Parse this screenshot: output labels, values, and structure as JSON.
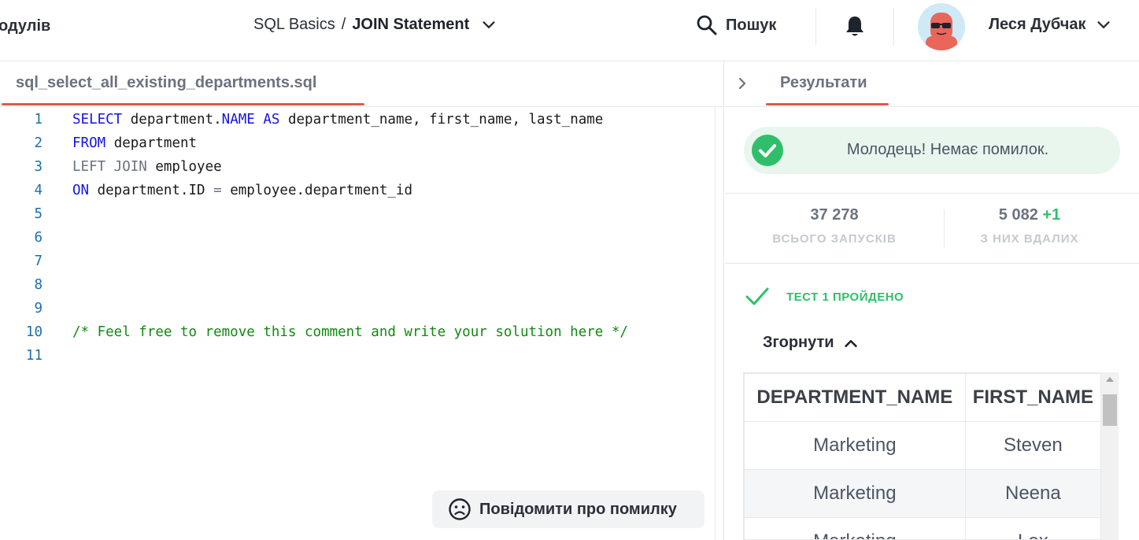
{
  "header": {
    "modules_link": "одулів",
    "breadcrumb": {
      "course": "SQL Basics",
      "separator": "/",
      "lesson": "JOIN Statement"
    },
    "search_label": "Пошук",
    "user_name": "Леся Дубчак"
  },
  "editor": {
    "file_name": "sql_select_all_existing_departments.sql",
    "line_numbers": [
      "1",
      "2",
      "3",
      "4",
      "5",
      "6",
      "7",
      "8",
      "9",
      "10",
      "11"
    ],
    "lines": {
      "l1": {
        "kw1": "SELECT",
        "a": " department.",
        "kw2": "NAME",
        "b": " ",
        "kw3": "AS",
        "c": " department_name, first_name, last_name"
      },
      "l2": {
        "kw1": "FROM",
        "a": " department"
      },
      "l3": {
        "kw1": "LEFT JOIN",
        "a": " employee"
      },
      "l4": {
        "kw1": "ON",
        "a": " department.ID ",
        "op": "=",
        "b": " employee.department_id"
      },
      "l10": {
        "comment": "/* Feel free to remove this comment and write your solution here */"
      }
    },
    "report_button": "Повідомити про помилку"
  },
  "results": {
    "tab_label": "Результати",
    "success_message": "Молодець! Немає помилок.",
    "stats": {
      "total_runs": "37 278",
      "total_runs_label": "ВСЬОГО ЗАПУСКІВ",
      "successful_runs": "5 082",
      "successful_delta": "+1",
      "successful_label": "З НИХ ВДАЛИХ"
    },
    "test_status": "ТЕСТ 1 ПРОЙДЕНО",
    "collapse_label": "Згорнути",
    "table": {
      "columns": [
        "DEPARTMENT_NAME",
        "FIRST_NAME"
      ],
      "rows": [
        [
          "Marketing",
          "Steven"
        ],
        [
          "Marketing",
          "Neena"
        ],
        [
          "Marketing",
          "Lex"
        ]
      ]
    }
  },
  "colors": {
    "accent": "#e0584a",
    "success": "#2fbf6b",
    "keyword": "#1414e6",
    "comment": "#128a12"
  }
}
